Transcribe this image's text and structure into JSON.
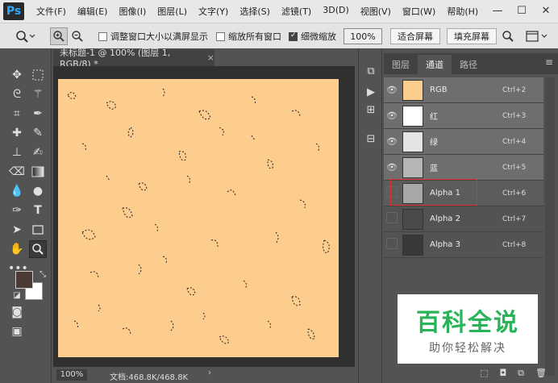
{
  "app": {
    "logo": "Ps"
  },
  "menu": [
    "文件(F)",
    "编辑(E)",
    "图像(I)",
    "图层(L)",
    "文字(Y)",
    "选择(S)",
    "滤镜(T)",
    "3D(D)",
    "视图(V)",
    "窗口(W)",
    "帮助(H)"
  ],
  "window_controls": {
    "minimize": "—",
    "maximize": "☐",
    "close": "✕"
  },
  "options": {
    "resize_windows_label": "调整窗口大小以满屏显示",
    "resize_windows_checked": false,
    "zoom_all_label": "缩放所有窗口",
    "zoom_all_checked": false,
    "scrubby_zoom_label": "细微缩放",
    "scrubby_zoom_checked": true,
    "zoom_value": "100%",
    "fit_screen": "适合屏幕",
    "fill_screen": "填充屏幕"
  },
  "document": {
    "tab_title": "未标题-1 @ 100% (图层 1, RGB/8) *",
    "tab_close": "×",
    "status_zoom": "100%",
    "status_info": "文档:468.8K/468.8K",
    "canvas_color": "#fccd8d"
  },
  "panel": {
    "tabs": [
      "图层",
      "通道",
      "路径"
    ],
    "active_tab": "通道",
    "channels": [
      {
        "name": "RGB",
        "shortcut": "Ctrl+2",
        "visible": true,
        "thumb": "#fccd8d"
      },
      {
        "name": "红",
        "shortcut": "Ctrl+3",
        "visible": true,
        "thumb": "#ffffff"
      },
      {
        "name": "绿",
        "shortcut": "Ctrl+4",
        "visible": true,
        "thumb": "#e4e4e4"
      },
      {
        "name": "蓝",
        "shortcut": "Ctrl+5",
        "visible": true,
        "thumb": "#b6b6b6"
      },
      {
        "name": "Alpha 1",
        "shortcut": "Ctrl+6",
        "visible": false,
        "thumb": "#a8a8a8"
      },
      {
        "name": "Alpha 2",
        "shortcut": "Ctrl+7",
        "visible": false,
        "thumb": "#4a4a4a"
      },
      {
        "name": "Alpha 3",
        "shortcut": "Ctrl+8",
        "visible": false,
        "thumb": "#383838"
      }
    ]
  },
  "colors": {
    "foreground": "#4a3a33",
    "background": "#ffffff"
  },
  "watermark": {
    "title": "百科全说",
    "subtitle": "助你轻松解决"
  }
}
